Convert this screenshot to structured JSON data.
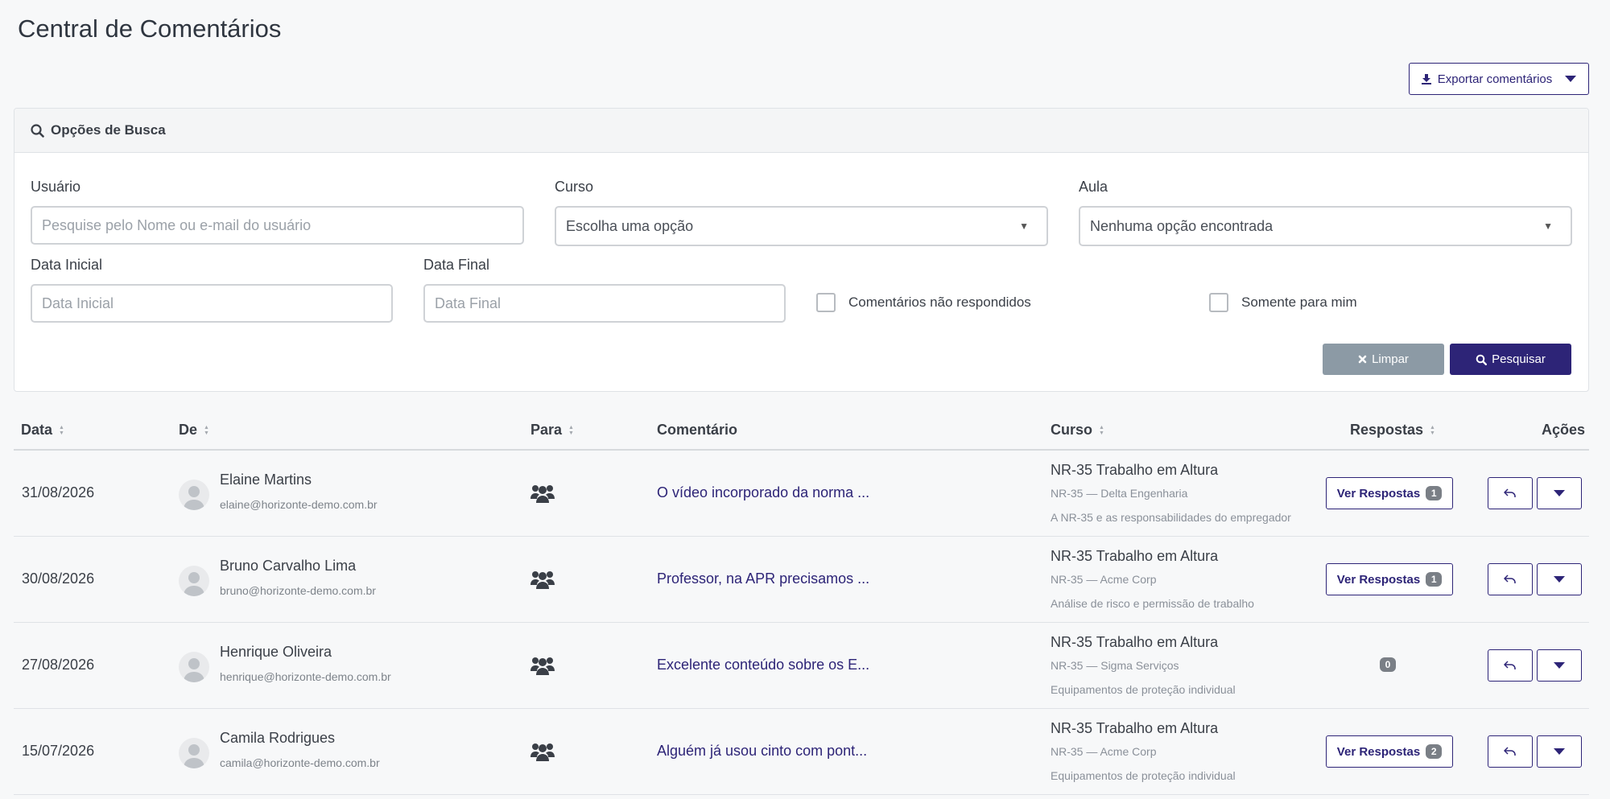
{
  "page": {
    "title": "Central de Comentários"
  },
  "toolbar": {
    "export_label": "Exportar comentários"
  },
  "search": {
    "title": "Opções de Busca",
    "usuario_label": "Usuário",
    "usuario_placeholder": "Pesquise pelo Nome ou e-mail do usuário",
    "curso_label": "Curso",
    "curso_value": "Escolha uma opção",
    "aula_label": "Aula",
    "aula_value": "Nenhuma opção encontrada",
    "data_inicial_label": "Data Inicial",
    "data_inicial_placeholder": "Data Inicial",
    "data_final_label": "Data Final",
    "data_final_placeholder": "Data Final",
    "nao_respondidos_label": "Comentários não respondidos",
    "somente_mim_label": "Somente para mim",
    "clear_label": "Limpar",
    "search_label": "Pesquisar"
  },
  "table": {
    "headers": {
      "data": "Data",
      "de": "De",
      "para": "Para",
      "comentario": "Comentário",
      "curso": "Curso",
      "respostas": "Respostas",
      "acoes": "Ações"
    },
    "ver_respostas_label": "Ver Respostas",
    "rows": [
      {
        "date": "31/08/2026",
        "name": "Elaine Martins",
        "email": "elaine@horizonte-demo.com.br",
        "comment": "O vídeo incorporado da norma ...",
        "course": "NR-35 Trabalho em Altura",
        "company": "NR-35 — Delta Engenharia",
        "lesson": "A NR-35 e as responsabilidades do empregador",
        "replies": "1"
      },
      {
        "date": "30/08/2026",
        "name": "Bruno Carvalho Lima",
        "email": "bruno@horizonte-demo.com.br",
        "comment": "Professor, na APR precisamos ...",
        "course": "NR-35 Trabalho em Altura",
        "company": "NR-35 — Acme Corp",
        "lesson": "Análise de risco e permissão de trabalho",
        "replies": "1"
      },
      {
        "date": "27/08/2026",
        "name": "Henrique Oliveira",
        "email": "henrique@horizonte-demo.com.br",
        "comment": "Excelente conteúdo sobre os E...",
        "course": "NR-35 Trabalho em Altura",
        "company": "NR-35 — Sigma Serviços",
        "lesson": "Equipamentos de proteção individual",
        "replies": "0"
      },
      {
        "date": "15/07/2026",
        "name": "Camila Rodrigues",
        "email": "camila@horizonte-demo.com.br",
        "comment": "Alguém já usou cinto com pont...",
        "course": "NR-35 Trabalho em Altura",
        "company": "NR-35 — Acme Corp",
        "lesson": "Equipamentos de proteção individual",
        "replies": "2"
      }
    ]
  },
  "colors": {
    "accent": "#2d2477",
    "clear_button": "#8c9aa5",
    "badge": "#7a7f86"
  }
}
